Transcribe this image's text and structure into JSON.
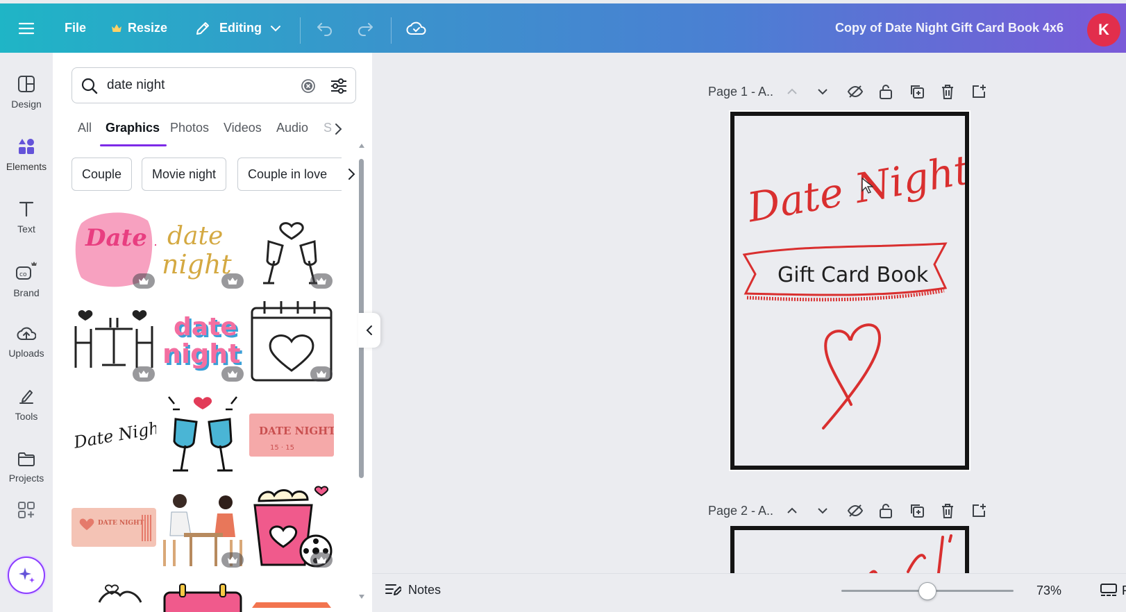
{
  "topbar": {
    "file_label": "File",
    "resize_label": "Resize",
    "editing_label": "Editing",
    "doc_title": "Copy of Date Night Gift Card Book 4x6",
    "avatar_initial": "K",
    "accent": "#8b3dff"
  },
  "rail": {
    "items": [
      {
        "label": "Design",
        "icon": "layout-icon"
      },
      {
        "label": "Elements",
        "icon": "elements-icon"
      },
      {
        "label": "Text",
        "icon": "text-icon"
      },
      {
        "label": "Brand",
        "icon": "brand-icon"
      },
      {
        "label": "Uploads",
        "icon": "cloud-upload-icon"
      },
      {
        "label": "Tools",
        "icon": "pen-icon"
      },
      {
        "label": "Projects",
        "icon": "folder-icon"
      }
    ]
  },
  "panel": {
    "search_value": "date night",
    "tabs": [
      "All",
      "Graphics",
      "Photos",
      "Videos",
      "Audio",
      "S"
    ],
    "active_tab": "Graphics",
    "chips": [
      "Couple",
      "Movie night",
      "Couple in love"
    ],
    "graphics": [
      {
        "label": "Date Night",
        "premium": true
      },
      {
        "label": "date night",
        "premium": true
      },
      {
        "premium": true
      },
      {
        "premium": true
      },
      {
        "label": "date night",
        "premium": true
      },
      {
        "premium": true
      },
      {
        "label": "Date Night!",
        "premium": false
      },
      {
        "premium": false
      },
      {
        "label": "DATE NIGHT",
        "premium": false
      },
      {
        "label": "DATE NIGHT",
        "premium": false
      },
      {
        "premium": true
      },
      {
        "premium": true
      }
    ]
  },
  "canvas": {
    "page1_label": "Page 1 - A..",
    "page2_label": "Page 2 - A..",
    "page_title": "Date Night!",
    "banner_text": "Gift Card Book",
    "design_color": "#d92f2f"
  },
  "bottombar": {
    "notes_label": "Notes",
    "zoom": "73%",
    "zoom_fraction": 0.5
  }
}
